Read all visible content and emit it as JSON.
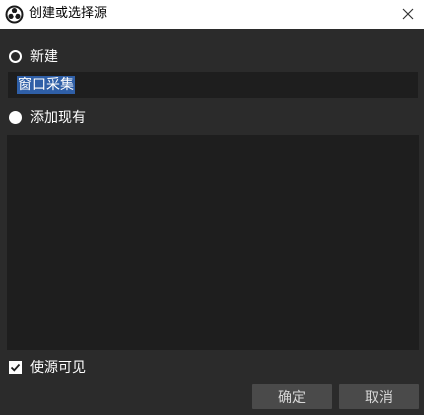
{
  "window": {
    "title": "创建或选择源",
    "icon": "obs-logo-icon",
    "close_icon": "close-icon"
  },
  "options": {
    "new_label": "新建",
    "new_selected": true,
    "existing_label": "添加现有",
    "existing_selected": false
  },
  "name_input": {
    "value": "窗口采集",
    "text_selected": true
  },
  "existing_sources": [],
  "visible_checkbox": {
    "label": "使源可见",
    "checked": true
  },
  "buttons": {
    "ok_label": "确定",
    "cancel_label": "取消"
  },
  "colors": {
    "background": "#2b2b2b",
    "field": "#1e1e1e",
    "selection": "#2f5fa7",
    "button": "#4a4a4a"
  }
}
